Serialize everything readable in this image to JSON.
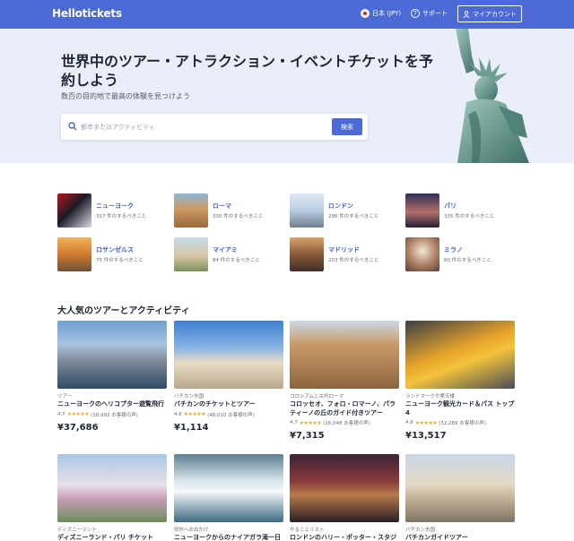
{
  "header": {
    "logo": "Hellotickets",
    "language": "日本 (JPY)",
    "support": "サポート",
    "account": "マイアカウント"
  },
  "hero": {
    "title": "世界中のツアー・アトラクション・イベントチケットを予約しよう",
    "subtitle": "数百の目的地で最高の体験を見つけよう",
    "search_placeholder": "都市またはアクティビティ",
    "search_button": "検索"
  },
  "destinations": [
    {
      "name": "ニューヨーク",
      "count": "317 件のするべきこと"
    },
    {
      "name": "ローマ",
      "count": "330 件のするべきこと"
    },
    {
      "name": "ロンドン",
      "count": "296 件のするべきこと"
    },
    {
      "name": "パリ",
      "count": "335 件のするべきこと"
    },
    {
      "name": "ロサンゼルス",
      "count": "75 件のするべきこと"
    },
    {
      "name": "マイアミ",
      "count": "84 件のするべきこと"
    },
    {
      "name": "マドリッド",
      "count": "203 件のするべきこと"
    },
    {
      "name": "ミラノ",
      "count": "80 件のするべきこと"
    }
  ],
  "popular": {
    "title": "大人気のツアーとアクティビティ",
    "cards": [
      {
        "category": "ツアー",
        "title": "ニューヨークのヘリコプター遊覧飛行",
        "rating": "4.7",
        "reviews": "(18,992 お客様の声)",
        "price": "¥37,686"
      },
      {
        "category": "バチカン市国",
        "title": "バチカンのチケットとツアー",
        "rating": "4.6",
        "reviews": "(48,010 お客様の声)",
        "price": "¥1,114"
      },
      {
        "category": "コロシアムと古代ローマ",
        "title": "コロッセオ、フォロ・ロマーノ、パラティーノの丘のガイド付きツアー",
        "rating": "4.7",
        "reviews": "(16,048 お客様の声)",
        "price": "¥7,315"
      },
      {
        "category": "ランドマークや摩天楼",
        "title": "ニューヨーク観光カード＆パス トップ 4",
        "rating": "4.6",
        "reviews": "(32,289 お客様の声)",
        "price": "¥13,517"
      },
      {
        "category": "ディズニーランド",
        "title": "ディズニーランド・パリ チケット"
      },
      {
        "category": "郊外へお出かけ",
        "title": "ニューヨークからのナイアガラ滝一日"
      },
      {
        "category": "やることリスト",
        "title": "ロンドンのハリー・ポッター・スタジ"
      },
      {
        "category": "バチカン市国",
        "title": "バチカンガイドツアー"
      }
    ]
  },
  "colors": {
    "brand": "#4b6ad6",
    "hero_bg": "#e9eef9",
    "star": "#f5a623"
  },
  "icons": {
    "search": "search-icon",
    "flag": "japan-flag-icon",
    "help": "help-icon",
    "user": "user-icon"
  }
}
